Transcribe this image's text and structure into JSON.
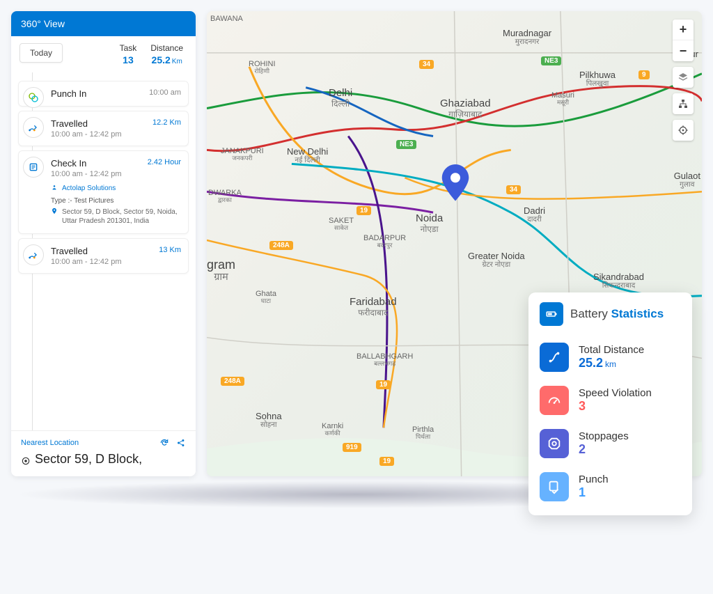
{
  "sidebar": {
    "header": "360° View",
    "today_label": "Today",
    "task_label": "Task",
    "task_value": "13",
    "distance_label": "Distance",
    "distance_value": "25.2",
    "distance_unit": "Km",
    "events": [
      {
        "title": "Punch In",
        "time": "",
        "right": "10:00 am",
        "right_gray": true
      },
      {
        "title": "Travelled",
        "time": "10:00 am - 12:42 pm",
        "right": "12.2 Km"
      },
      {
        "title": "Check In",
        "time": "10:00 am - 12:42 pm",
        "right": "2.42 Hour",
        "company": "Actolap Solutions",
        "type_label": "Type :-",
        "type_value": "Test Pictures",
        "address": "Sector 59, D Block, Sector 59, Noida, Uttar Pradesh 201301, India"
      },
      {
        "title": "Travelled",
        "time": "10:00 am - 12:42 pm",
        "right": "13 Km"
      }
    ],
    "nearest_label": "Nearest Location",
    "nearest_value": "Sector 59, D Block,"
  },
  "map": {
    "labels": {
      "bawana": "BAWANA",
      "rohini": "ROHINI",
      "rohini_hi": "रोहिणी",
      "delhi": "Delhi",
      "delhi_hi": "दिल्ली",
      "ghaziabad": "Ghaziabad",
      "ghaziabad_hi": "गाज़ियाबाद",
      "newdelhi": "New Delhi",
      "newdelhi_hi": "नई दिल्ली",
      "janakpuri": "JANAKPURI",
      "janakpuri_hi": "जनकपरी",
      "dwarka": "DWARKA",
      "dwarka_hi": "द्वारका",
      "saket": "SAKET",
      "saket_hi": "साकेत",
      "badarpur": "BADARPUR",
      "badarpur_hi": "बदरपुर",
      "noida": "Noida",
      "noida_hi": "नोएडा",
      "greaternoida": "Greater Noida",
      "greaternoida_hi": "ग्रेटर नोएडा",
      "dadri": "Dadri",
      "dadri_hi": "दादरी",
      "gram_hi": "ग्राम",
      "ghata": "Ghata",
      "ghata_hi": "घाटा",
      "faridabad": "Faridabad",
      "faridabad_hi": "फरीदाबाद",
      "ballabhgarh": "BALLABHGARH",
      "ballabhgarh_hi": "बल्लभगढ़",
      "sohna": "Sohna",
      "sohna_hi": "सोहना",
      "karnki": "Karnki",
      "karnki_hi": "कर्णकी",
      "pirthla": "Pirthla",
      "pirthla_hi": "पिर्थला",
      "muradnagar": "Muradnagar",
      "muradnagar_hi": "मुरादनगर",
      "pilkhuwa": "Pilkhuwa",
      "pilkhuwa_hi": "पिलखुवा",
      "masuri": "Masuri",
      "masuri_hi": "मसूरी",
      "sikandrabad": "Sikandrabad",
      "sikandrabad_hi": "सिकन्दराबाद",
      "gulaot": "Gulaot",
      "gulaot_hi": "गुलाव",
      "hapur_part": "Hanur",
      "gram_left": "gram"
    },
    "roads": {
      "n34": "34",
      "ne3": "NE3",
      "n19": "19",
      "n248a": "248A",
      "n919": "919",
      "n9": "9"
    }
  },
  "stats": {
    "title_part1": "Battery ",
    "title_part2": "Statistics",
    "rows": [
      {
        "label": "Total Distance",
        "value": "25.2",
        "unit": "km",
        "color": "blue"
      },
      {
        "label": "Speed Violation",
        "value": "3",
        "unit": "",
        "color": "red"
      },
      {
        "label": "Stoppages",
        "value": "2",
        "unit": "",
        "color": "indigo"
      },
      {
        "label": "Punch",
        "value": "1",
        "unit": "",
        "color": "lblue"
      }
    ]
  }
}
